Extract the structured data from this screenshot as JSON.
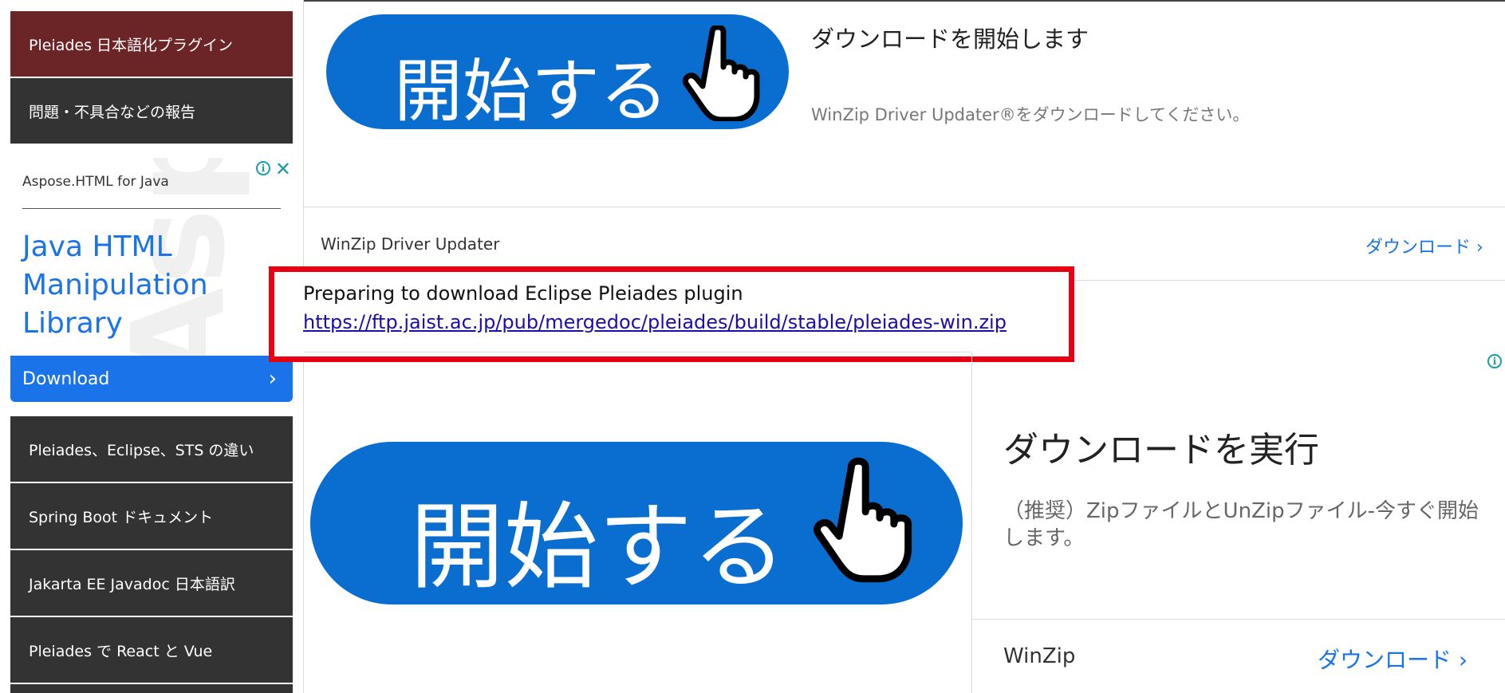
{
  "sidebar": {
    "items_top": [
      {
        "label": "Pleiades 日本語化プラグイン",
        "active": true
      },
      {
        "label": "問題・不具合などの報告",
        "active": false
      }
    ],
    "ad": {
      "brand": "Aspose.HTML for Java",
      "headline": "Java HTML Manipulation Library",
      "cta": "Download",
      "watermark": "Asp"
    },
    "items_bottom": [
      {
        "label": "Pleiades、Eclipse、STS の違い"
      },
      {
        "label": "Spring Boot ドキュメント"
      },
      {
        "label": "Jakarta EE Javadoc 日本語訳"
      },
      {
        "label": "Pleiades で React と Vue"
      }
    ]
  },
  "top_ad": {
    "button_text": "開始する",
    "title": "ダウンロードを開始します",
    "subtitle": "WinZip Driver Updater®をダウンロードしてください。"
  },
  "row1": {
    "label": "WinZip Driver Updater",
    "link": "ダウンロード"
  },
  "download_notice": {
    "text": "Preparing to download Eclipse Pleiades plugin",
    "url": "https://ftp.jaist.ac.jp/pub/mergedoc/pleiades/build/stable/pleiades-win.zip"
  },
  "lower_ad": {
    "button_text": "開始する",
    "title": "ダウンロードを実行",
    "subtitle": "（推奨）ZipファイルとUnZipファイル-今すぐ開始します。"
  },
  "row2": {
    "label": "WinZip",
    "link": "ダウンロード"
  },
  "colors": {
    "accent": "#0a6ed1",
    "highlight": "#e60012",
    "nav": "#333333",
    "nav_active": "#6b2527"
  }
}
